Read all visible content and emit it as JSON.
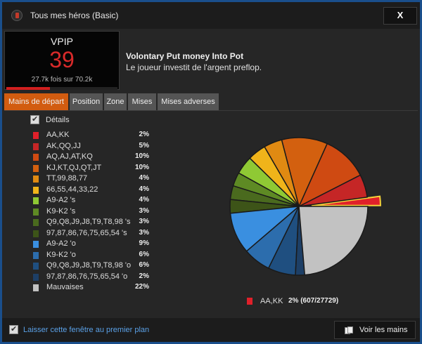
{
  "window": {
    "title": "Tous mes héros (Basic)",
    "close_label": "X"
  },
  "stat": {
    "name": "VPIP",
    "value": "39",
    "count": "27.7k fois sur 70.2k",
    "progress_percent": 39,
    "accent_color": "#d31f1f"
  },
  "description": {
    "title": "Volontary Put money Into Pot",
    "text": "Le joueur investit de l'argent preflop."
  },
  "tabs": [
    {
      "label": "Mains de départ",
      "active": true
    },
    {
      "label": "Position",
      "active": false
    },
    {
      "label": "Zone",
      "active": false
    },
    {
      "label": "Mises",
      "active": false
    },
    {
      "label": "Mises adverses",
      "active": false
    }
  ],
  "details": {
    "label": "Détails",
    "checked": true
  },
  "chart_data": {
    "type": "pie",
    "title": "",
    "selected_index": 0,
    "selected_label": "AA,KK",
    "selected_value_text": "2% (607/27729)",
    "slices": [
      {
        "label": "AA,KK",
        "value": 2,
        "display": "2%",
        "color": "#e0202a"
      },
      {
        "label": "AK,QQ,JJ",
        "value": 5,
        "display": "5%",
        "color": "#c52626"
      },
      {
        "label": "AQ,AJ,AT,KQ",
        "value": 10,
        "display": "10%",
        "color": "#cf4a12"
      },
      {
        "label": "KJ,KT,QJ,QT,JT",
        "value": 10,
        "display": "10%",
        "color": "#d3600f"
      },
      {
        "label": "TT,99,88,77",
        "value": 4,
        "display": "4%",
        "color": "#e08a12"
      },
      {
        "label": "66,55,44,33,22",
        "value": 4,
        "display": "4%",
        "color": "#f0b41a"
      },
      {
        "label": "A9-A2 's",
        "value": 4,
        "display": "4%",
        "color": "#8fc934"
      },
      {
        "label": "K9-K2 's",
        "value": 3,
        "display": "3%",
        "color": "#5e8a24"
      },
      {
        "label": "Q9,Q8,J9,J8,T9,T8,98 's",
        "value": 3,
        "display": "3%",
        "color": "#4a6a1e"
      },
      {
        "label": "97,87,86,76,75,65,54 's",
        "value": 3,
        "display": "3%",
        "color": "#3d5418"
      },
      {
        "label": "A9-A2 'o",
        "value": 9,
        "display": "9%",
        "color": "#3a8fe0"
      },
      {
        "label": "K9-K2 'o",
        "value": 6,
        "display": "6%",
        "color": "#2c6dad"
      },
      {
        "label": "Q9,Q8,J9,J8,T9,T8,98 'o",
        "value": 6,
        "display": "6%",
        "color": "#1f4f80"
      },
      {
        "label": "97,87,86,76,75,65,54 'o",
        "value": 2,
        "display": "2%",
        "color": "#1d3f66"
      },
      {
        "label": "Mauvaises",
        "value": 22,
        "display": "22%",
        "color": "#c2c2c2"
      }
    ]
  },
  "footer": {
    "topmost_label": "Laisser cette fenêtre au premier plan",
    "topmost_checked": true,
    "view_hands_label": "Voir les mains"
  },
  "icons": {
    "app": "app-logo-icon",
    "check": "check-icon",
    "cards": "cards-icon"
  }
}
